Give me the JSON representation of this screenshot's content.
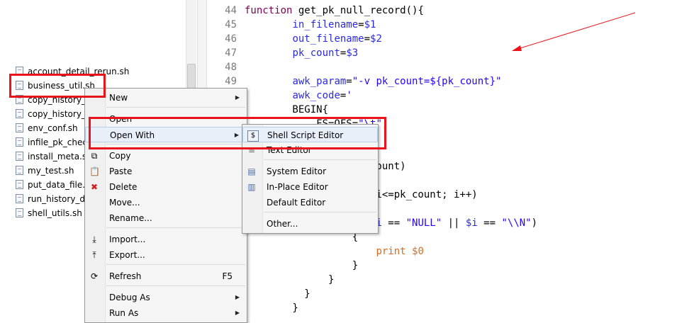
{
  "explorer": {
    "files": [
      "account_detail_rerun.sh",
      "business_util.sh",
      "copy_history_",
      "copy_history_",
      "env_conf.sh",
      "infile_pk_chec",
      "install_meta.s",
      "my_test.sh",
      "put_data_file.s",
      "run_history_d",
      "shell_utils.sh"
    ]
  },
  "editor": {
    "lines": [
      {
        "num": "44",
        "parts": [
          [
            "kw",
            "function"
          ],
          [
            "plain",
            " get_pk_null_record(){"
          ]
        ]
      },
      {
        "num": "45",
        "parts": [
          [
            "plain",
            "        "
          ],
          [
            "var",
            "in_filename"
          ],
          [
            "plain",
            "="
          ],
          [
            "var",
            "$1"
          ]
        ]
      },
      {
        "num": "46",
        "parts": [
          [
            "plain",
            "        "
          ],
          [
            "var",
            "out_filename"
          ],
          [
            "plain",
            "="
          ],
          [
            "var",
            "$2"
          ]
        ]
      },
      {
        "num": "47",
        "parts": [
          [
            "plain",
            "        "
          ],
          [
            "var",
            "pk_count"
          ],
          [
            "plain",
            "="
          ],
          [
            "var",
            "$3"
          ]
        ]
      },
      {
        "num": "48",
        "parts": []
      },
      {
        "num": "49",
        "parts": [
          [
            "plain",
            "        "
          ],
          [
            "var",
            "awk_param"
          ],
          [
            "plain",
            "="
          ],
          [
            "str",
            "\"-v pk_count=${pk_count}\""
          ]
        ]
      },
      {
        "num": "",
        "parts": [
          [
            "plain",
            "        "
          ],
          [
            "var",
            "awk_code"
          ],
          [
            "plain",
            "="
          ],
          [
            "str",
            "'"
          ]
        ]
      },
      {
        "num": "",
        "parts": [
          [
            "plain",
            "        BEGIN{"
          ]
        ]
      },
      {
        "num": "",
        "parts": [
          [
            "plain",
            "            FS=OFS="
          ],
          [
            "str",
            "\"\\t\";"
          ]
        ]
      },
      {
        "num": "",
        "parts": []
      },
      {
        "num": "",
        "parts": []
      },
      {
        "num": "",
        "parts": [
          [
            "plain",
            "                = pk_count)"
          ]
        ]
      },
      {
        "num": "",
        "parts": []
      },
      {
        "num": "",
        "parts": [
          [
            "plain",
            "                (i=1; i<=pk_count; i++)"
          ]
        ]
      },
      {
        "num": "",
        "parts": []
      },
      {
        "num": "",
        "parts": [
          [
            "plain",
            "                  "
          ],
          [
            "kw",
            "if"
          ],
          [
            "plain",
            "("
          ],
          [
            "var",
            "$i"
          ],
          [
            "plain",
            " == "
          ],
          [
            "str",
            "\"NULL\""
          ],
          [
            "plain",
            " || "
          ],
          [
            "var",
            "$i"
          ],
          [
            "plain",
            " == "
          ],
          [
            "str",
            "\"\\\\N\""
          ],
          [
            "plain",
            ")"
          ]
        ]
      },
      {
        "num": "",
        "parts": [
          [
            "plain",
            "                  {"
          ]
        ]
      },
      {
        "num": "",
        "parts": [
          [
            "plain",
            "                      "
          ],
          [
            "orange",
            "print $0"
          ]
        ]
      },
      {
        "num": "",
        "parts": [
          [
            "plain",
            "                  }"
          ]
        ]
      },
      {
        "num": "",
        "parts": [
          [
            "plain",
            "              }"
          ]
        ]
      },
      {
        "num": "",
        "parts": [
          [
            "plain",
            "          }"
          ]
        ]
      },
      {
        "num": "",
        "parts": [
          [
            "plain",
            "        }"
          ]
        ]
      }
    ]
  },
  "context_menu": {
    "items": [
      {
        "label": "New",
        "submenu": true,
        "icon": ""
      },
      {
        "label": "Open",
        "submenu": false,
        "icon": ""
      },
      {
        "label": "Open With",
        "submenu": true,
        "icon": "",
        "highlight": true
      },
      {
        "label": "Copy",
        "submenu": false,
        "icon": "copy-icon"
      },
      {
        "label": "Paste",
        "submenu": false,
        "icon": "paste-icon"
      },
      {
        "label": "Delete",
        "submenu": false,
        "icon": "delete-icon"
      },
      {
        "label": "Move...",
        "submenu": false,
        "icon": ""
      },
      {
        "label": "Rename...",
        "submenu": false,
        "icon": ""
      },
      {
        "label": "Import...",
        "submenu": false,
        "icon": "import-icon"
      },
      {
        "label": "Export...",
        "submenu": false,
        "icon": "export-icon"
      },
      {
        "label": "Refresh",
        "submenu": false,
        "icon": "refresh-icon",
        "accel": "F5"
      },
      {
        "label": "Debug As",
        "submenu": true,
        "icon": ""
      },
      {
        "label": "Run As",
        "submenu": true,
        "icon": ""
      }
    ]
  },
  "open_with_menu": {
    "items": [
      {
        "label": "Shell Script Editor",
        "icon": "shell-script-icon",
        "highlight": true
      },
      {
        "label": "Text Editor",
        "icon": "text-file-icon"
      },
      {
        "label": "System Editor",
        "icon": "system-editor-icon"
      },
      {
        "label": "In-Place Editor",
        "icon": "inplace-editor-icon"
      },
      {
        "label": "Default Editor",
        "icon": ""
      },
      {
        "label": "Other...",
        "icon": ""
      }
    ]
  },
  "colors": {
    "annotation": "#e8141a",
    "keyword": "#7f0055",
    "variable": "#2a2ae0"
  }
}
